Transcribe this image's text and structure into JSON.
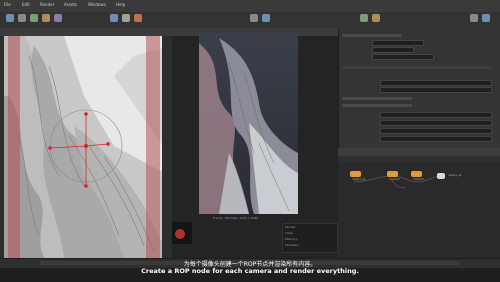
{
  "menubar": {
    "items": [
      "File",
      "Edit",
      "Render",
      "Assets",
      "Windows",
      "Help"
    ]
  },
  "render_view": {
    "caption": "Frame: 189  Size: 1920 x 1080",
    "stats_lines": [
      "Render",
      "Time:",
      "Memory:",
      "Samples:"
    ]
  },
  "network": {
    "nodes": [
      "mantra_ipr",
      "mantra2",
      "mantra3"
    ],
    "selected_node": "mantra_all"
  },
  "subtitles": {
    "zh": "为每个摄像头创建一个ROP节点并渲染所有内容。",
    "en": "Create a ROP node for each camera and render everything."
  },
  "colors": {
    "accent": "#e59a3a",
    "viewport_overlay": "#b45252",
    "handle": "#e02020"
  }
}
